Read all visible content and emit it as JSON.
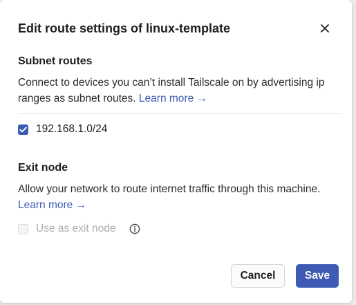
{
  "dialog": {
    "title": "Edit route settings of linux-template",
    "close_icon": "close-icon"
  },
  "subnet_routes": {
    "heading": "Subnet routes",
    "description": "Connect to devices you can’t install Tailscale on by advertising ip ranges as subnet routes.",
    "learn_more": "Learn more →",
    "routes": [
      {
        "label": "192.168.1.0/24",
        "checked": true
      }
    ]
  },
  "exit_node": {
    "heading": "Exit node",
    "description": "Allow your network to route internet traffic through this machine.",
    "learn_more": "Learn more →",
    "option_label": "Use as exit node",
    "option_checked": false,
    "option_disabled": true,
    "info_icon": "info-icon"
  },
  "actions": {
    "cancel_label": "Cancel",
    "save_label": "Save"
  },
  "colors": {
    "accent": "#3d5bb3",
    "text": "#1f1e1e",
    "disabled_text": "#aeadab"
  }
}
